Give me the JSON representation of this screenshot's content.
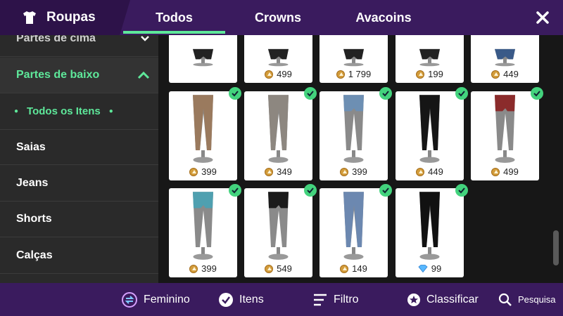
{
  "header": {
    "title": "Roupas",
    "tabs": [
      {
        "label": "Todos",
        "active": true
      },
      {
        "label": "Crowns",
        "active": false
      },
      {
        "label": "Avacoins",
        "active": false
      }
    ]
  },
  "sidebar": {
    "items": [
      {
        "label": "Partes de cima",
        "type": "category"
      },
      {
        "label": "Partes de baixo",
        "type": "category-open"
      },
      {
        "label": "Todos os Itens",
        "type": "selected"
      },
      {
        "label": "Saias",
        "type": "sub"
      },
      {
        "label": "Jeans",
        "type": "sub"
      },
      {
        "label": "Shorts",
        "type": "sub"
      },
      {
        "label": "Calças",
        "type": "sub"
      }
    ]
  },
  "grid": {
    "rows": [
      [
        {
          "price": "",
          "currency": "",
          "owned": false,
          "style": "dark-legs"
        },
        {
          "price": "499",
          "currency": "coin",
          "owned": false,
          "style": "dark-legs"
        },
        {
          "price": "1 799",
          "currency": "coin",
          "owned": false,
          "style": "dark-legs"
        },
        {
          "price": "199",
          "currency": "coin",
          "owned": false,
          "style": "dark-legs"
        },
        {
          "price": "449",
          "currency": "coin",
          "owned": false,
          "style": "jeans-legs"
        }
      ],
      [
        {
          "price": "399",
          "currency": "coin",
          "owned": true,
          "style": "tan-leggings"
        },
        {
          "price": "349",
          "currency": "coin",
          "owned": true,
          "style": "grey-leggings"
        },
        {
          "price": "399",
          "currency": "coin",
          "owned": true,
          "style": "denim-shorts"
        },
        {
          "price": "449",
          "currency": "coin",
          "owned": true,
          "style": "black-pants"
        },
        {
          "price": "499",
          "currency": "coin",
          "owned": true,
          "style": "plaid-skirt"
        }
      ],
      [
        {
          "price": "399",
          "currency": "coin",
          "owned": true,
          "style": "teal-shorts"
        },
        {
          "price": "549",
          "currency": "coin",
          "owned": true,
          "style": "black-skirt"
        },
        {
          "price": "149",
          "currency": "coin",
          "owned": true,
          "style": "ripped-jeans"
        },
        {
          "price": "99",
          "currency": "diamond",
          "owned": true,
          "style": "black-joggers"
        }
      ]
    ]
  },
  "bottom": {
    "gender_label": "Feminino",
    "items_label": "Itens",
    "filter_label": "Filtro",
    "sort_label": "Classificar",
    "search_label": "Pesquisa"
  },
  "colors": {
    "accent": "#5ee89a",
    "bar": "#3a1b5e",
    "coin": "#d39c3a",
    "owned": "#43d37d"
  }
}
